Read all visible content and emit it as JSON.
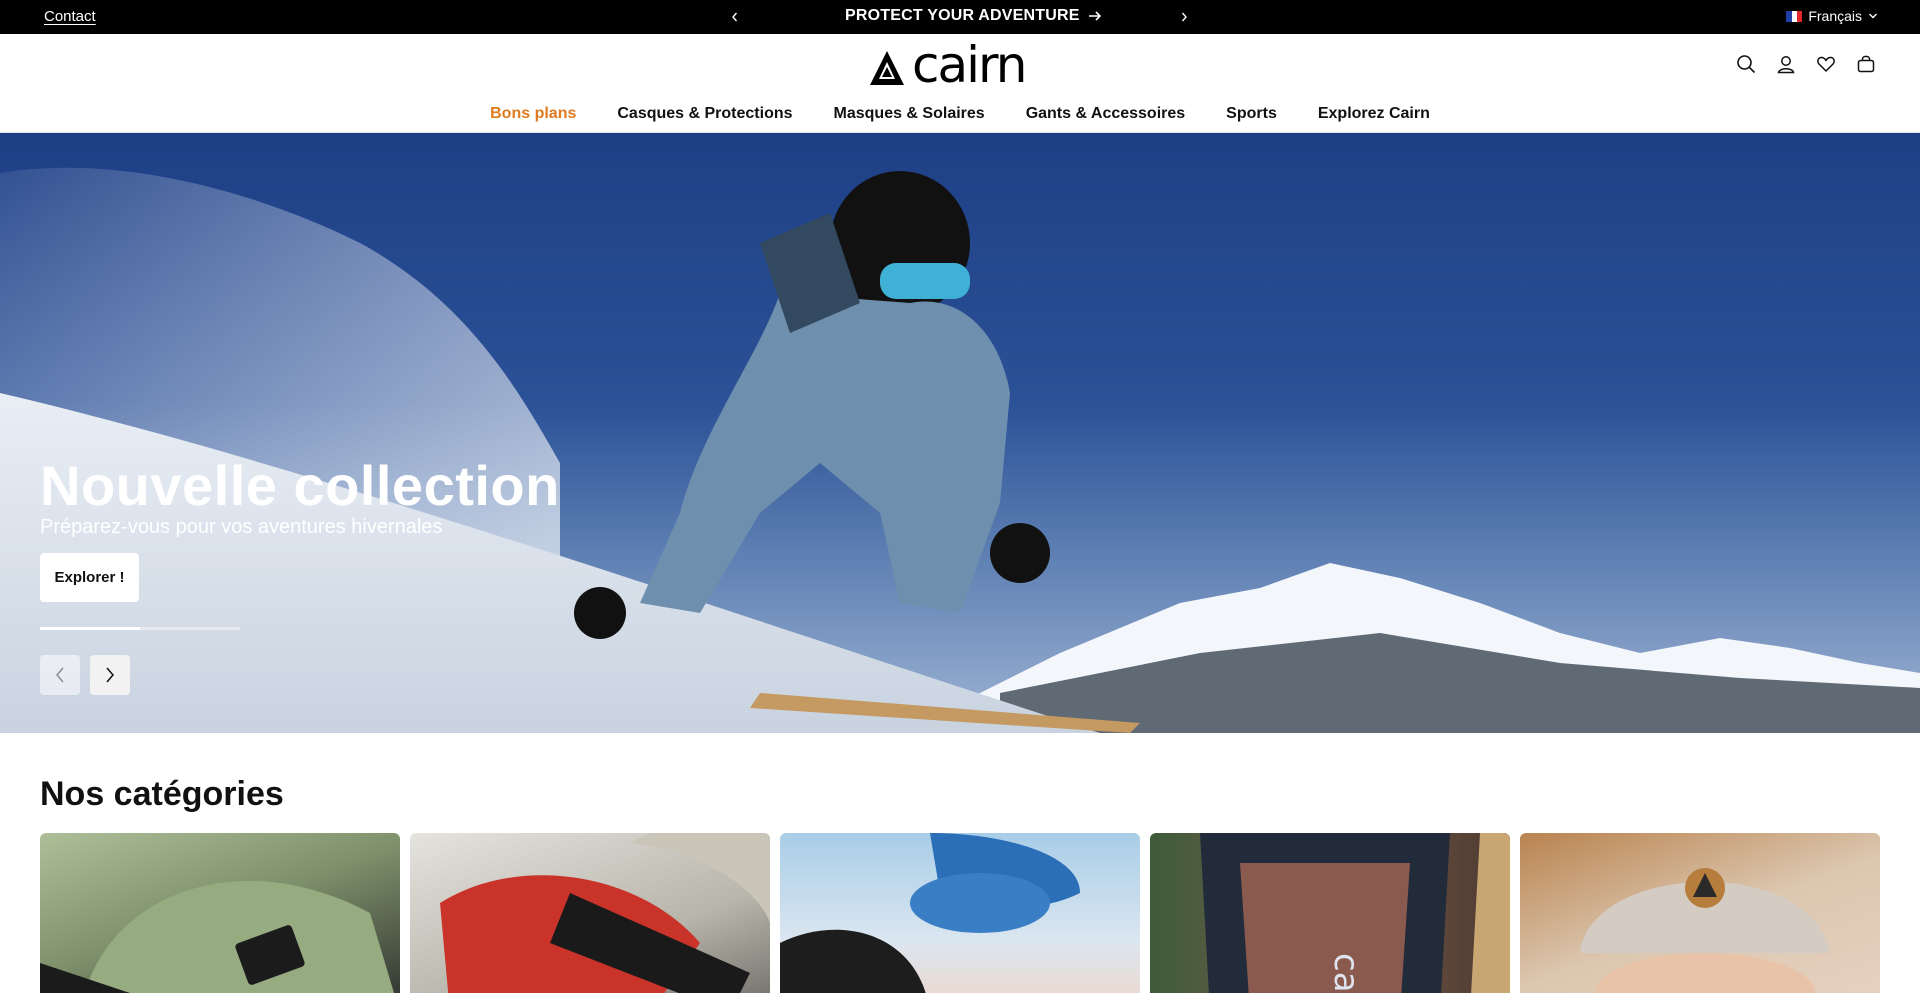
{
  "announcement": {
    "contact_label": "Contact",
    "promo_text": "PROTECT YOUR ADVENTURE",
    "language": "Français"
  },
  "header": {
    "logo_text": "cairn",
    "icons": [
      "search-icon",
      "account-icon",
      "wishlist-icon",
      "cart-icon"
    ],
    "nav": [
      {
        "label": "Bons plans"
      },
      {
        "label": "Casques & Protections"
      },
      {
        "label": "Masques & Solaires"
      },
      {
        "label": "Gants & Accessoires"
      },
      {
        "label": "Sports"
      },
      {
        "label": "Explorez Cairn"
      }
    ],
    "accent_color": "#e07a1f"
  },
  "hero": {
    "title": "Nouvelle collection",
    "subtitle": "Préparez-vous pour vos aventures hivernales",
    "cta_label": "Explorer !",
    "slide_progress": 0.5
  },
  "categories": {
    "title": "Nos catégories",
    "card_count": 5
  }
}
